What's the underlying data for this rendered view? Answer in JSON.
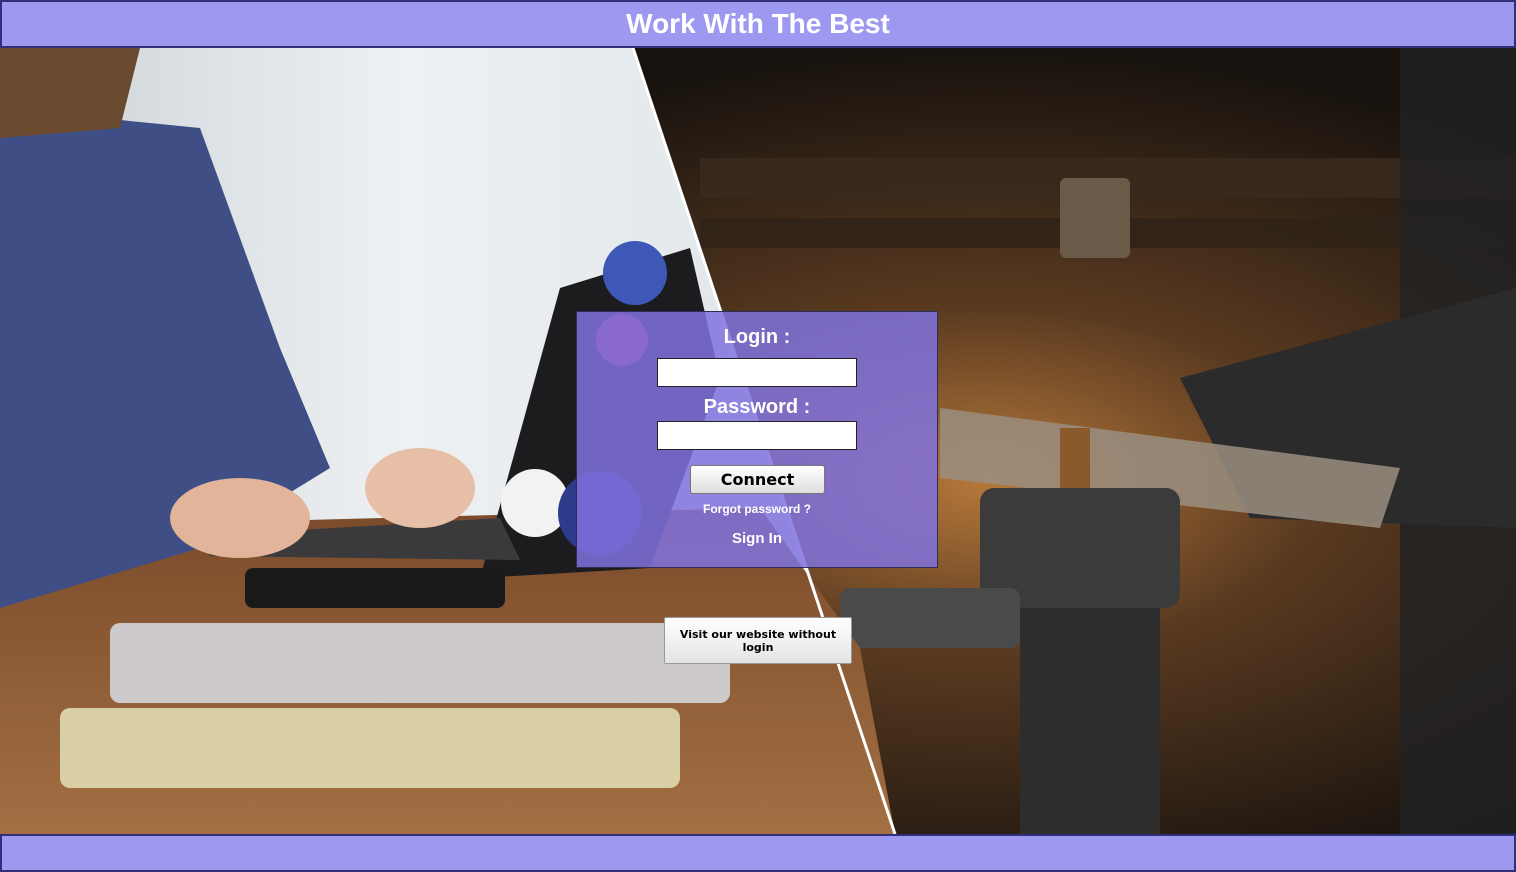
{
  "header": {
    "title": "Work With The Best"
  },
  "login_form": {
    "login_label": "Login :",
    "login_value": "",
    "password_label": "Password :",
    "password_value": "",
    "connect_label": "Connect",
    "forgot_label": "Forgot password ?",
    "signin_label": "Sign In"
  },
  "visit": {
    "label": "Visit our website without login"
  },
  "colors": {
    "header_bg": "#9d99f1",
    "header_border": "#2f2f7a",
    "panel_bg": "#8072de"
  }
}
